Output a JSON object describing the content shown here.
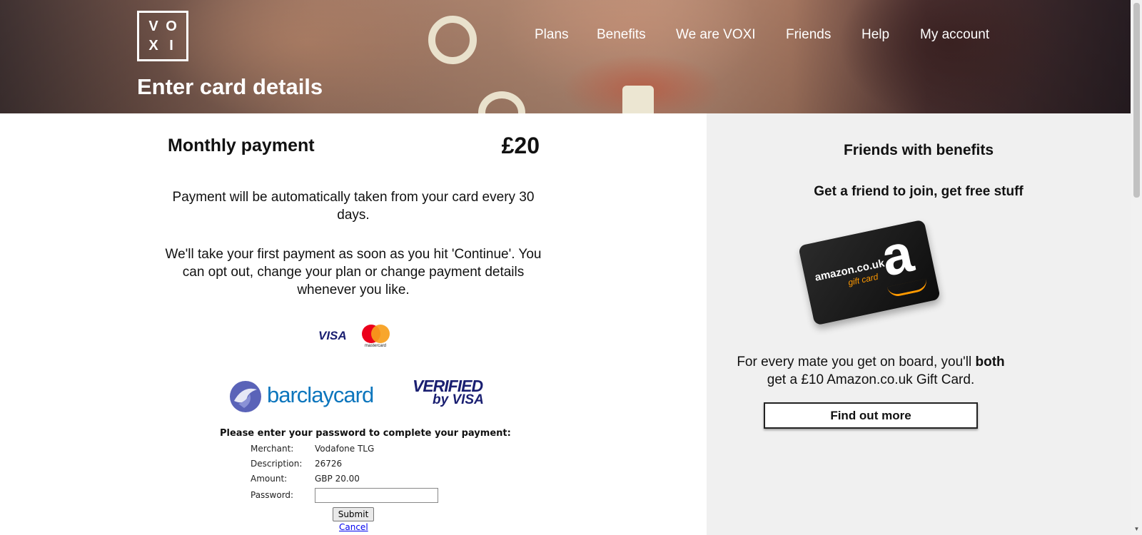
{
  "logo": {
    "letters": [
      "V",
      "O",
      "X",
      "I"
    ]
  },
  "nav": [
    "Plans",
    "Benefits",
    "We are VOXI",
    "Friends",
    "Help",
    "My account"
  ],
  "hero": {
    "title": "Enter card details"
  },
  "payment": {
    "label": "Monthly payment",
    "amount": "£20",
    "info1": "Payment will be automatically taken from your card every 30 days.",
    "info2": "We'll take your first payment as soon as you hit 'Continue'. You can opt out, change your plan or change payment details whenever you like."
  },
  "card_logos": {
    "visa": "VISA",
    "mastercard": "mastercard"
  },
  "secure": {
    "bank": "barclaycard",
    "vbv_line1": "VERIFIED",
    "vbv_line2": "by VISA",
    "prompt": "Please enter your password to complete your payment:",
    "merchant_label": "Merchant:",
    "merchant_value": "Vodafone TLG",
    "description_label": "Description:",
    "description_value": "26726",
    "amount_label": "Amount:",
    "amount_value": "GBP 20.00",
    "password_label": "Password:",
    "password_value": "",
    "submit": "Submit",
    "cancel": "Cancel"
  },
  "sidebar": {
    "title": "Friends with benefits",
    "subtitle": "Get a friend to join, get free stuff",
    "gift_card_brand": "amazon.co.uk",
    "gift_card_text": "gift card",
    "body_prefix": "For every mate you get on board, you'll ",
    "body_bold": "both",
    "body_suffix": " get a £10 Amazon.co.uk Gift Card.",
    "button": "Find out more"
  },
  "colors": {
    "accent_blue": "#0d76bd",
    "visa_navy": "#1a1f71",
    "sidebar_bg": "#f0f0f0"
  }
}
